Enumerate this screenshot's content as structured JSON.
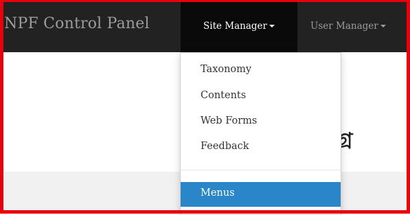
{
  "navbar": {
    "brand": "NPF Control Panel",
    "items": [
      {
        "label": "Site Manager",
        "active": true
      },
      {
        "label": "User Manager",
        "active": false
      }
    ]
  },
  "dropdown": {
    "items": [
      "Taxonomy",
      "Contents",
      "Web Forms",
      "Feedback"
    ],
    "highlighted": "Menus"
  },
  "page": {
    "heading_fragment": "গ্র"
  },
  "colors": {
    "navbar_bg": "#222222",
    "active_nav_bg": "#0a0a0a",
    "highlight": "#2a86c8",
    "frame": "#e8000d"
  }
}
